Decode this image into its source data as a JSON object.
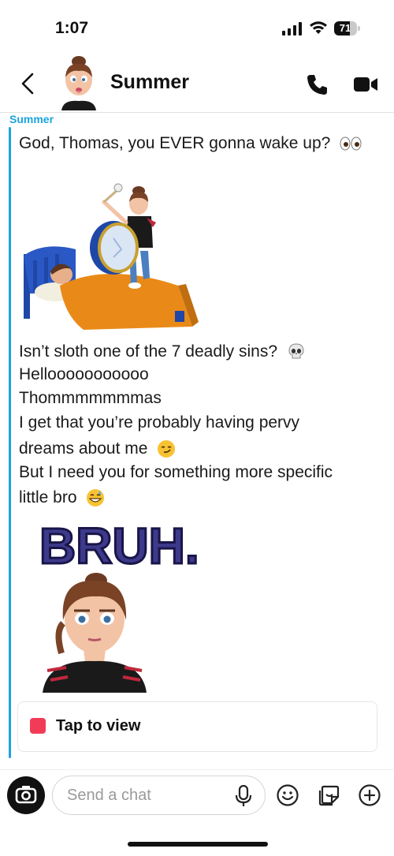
{
  "status_bar": {
    "time": "1:07",
    "battery_percent": "71",
    "battery_level": 0.71
  },
  "header": {
    "contact_name": "Summer",
    "back_icon": "chevron-left-icon",
    "call_icon": "phone-icon",
    "video_icon": "video-camera-icon"
  },
  "thread": {
    "sender_label": "Summer",
    "accent_color": "#1ba4e0",
    "messages": [
      {
        "text": "God, Thomas, you EVER gonna wake up?",
        "emoji": "eyes"
      },
      {
        "type": "sticker",
        "description_icon": "bitmoji-drum-wakeup-sticker"
      },
      {
        "text": "Isn’t sloth one of the 7 deadly sins?",
        "emoji": "skull"
      },
      {
        "text": "Hellooooooooooo"
      },
      {
        "text": "Thommmmmmmas"
      },
      {
        "text": "I get that you’re probably having pervy"
      },
      {
        "text": "dreams about me",
        "emoji": "smirk"
      },
      {
        "text": "But I need you for something more specific"
      },
      {
        "text": "little bro",
        "emoji": "grin-sweat"
      },
      {
        "type": "sticker",
        "caption": "BRUH."
      }
    ],
    "snap": {
      "label": "Tap to view",
      "color": "#f23c57"
    }
  },
  "composer": {
    "placeholder": "Send a chat",
    "camera_icon": "camera-icon",
    "mic_icon": "microphone-icon",
    "emoji_icon": "smiley-icon",
    "sticker_icon": "sticker-icon",
    "plus_icon": "plus-circle-icon"
  }
}
